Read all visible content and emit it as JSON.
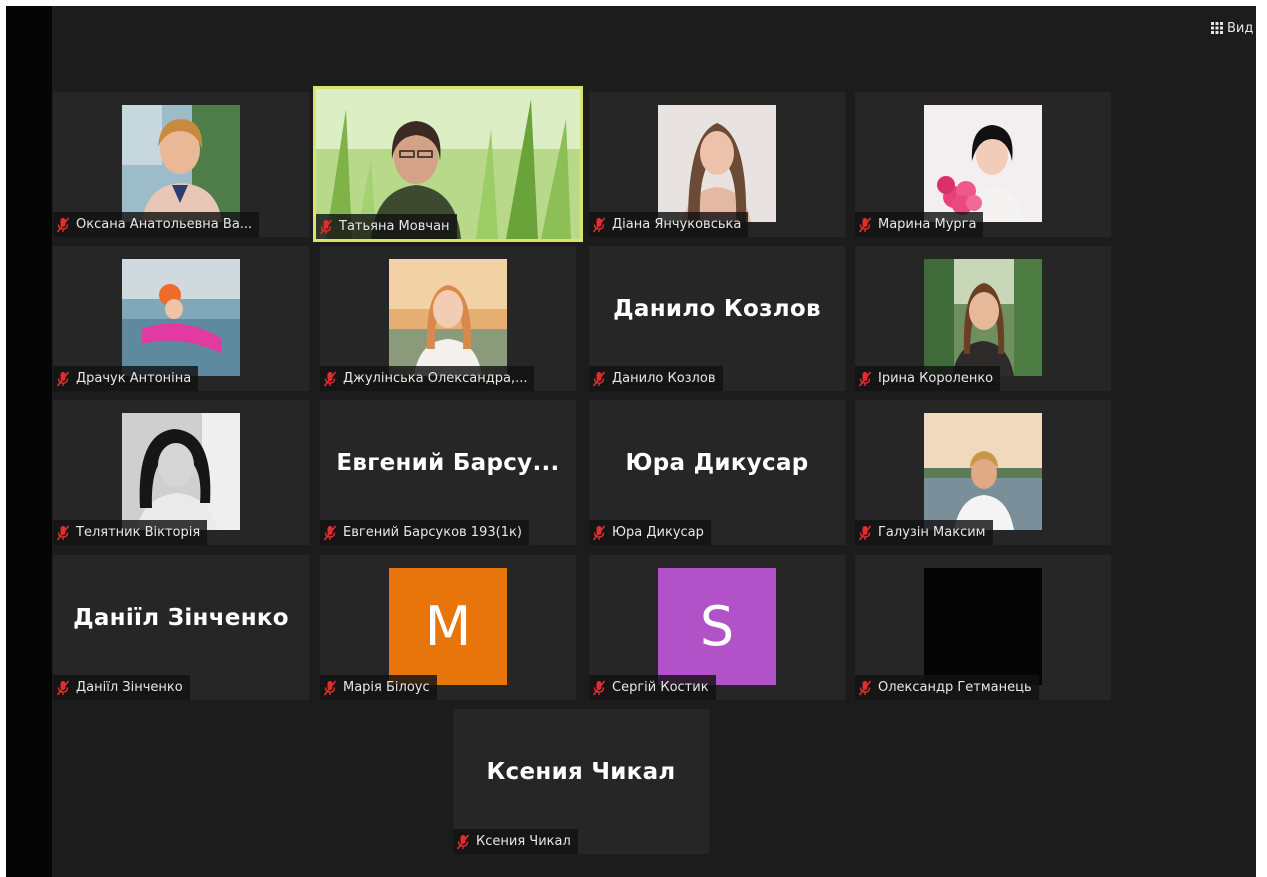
{
  "toolbar": {
    "view_label": "Вид"
  },
  "colors": {
    "background": "#1c1c1c",
    "tile": "#262626",
    "active_border": "#d9e36e",
    "muted_mic": "#e02d2d"
  },
  "participants": [
    {
      "name": "Оксана Анатольевна Ва...",
      "avatar": "photo"
    },
    {
      "name": "Татьяна Мовчан",
      "avatar": "photo",
      "speaking": true
    },
    {
      "name": "Діана Янчуковська",
      "avatar": "photo"
    },
    {
      "name": "Марина Мурга",
      "avatar": "photo"
    },
    {
      "name": "Драчук Антоніна",
      "avatar": "photo"
    },
    {
      "name": "Джулінська Олександра,...",
      "avatar": "photo"
    },
    {
      "name": "Данило Козлов",
      "display_name": "Данило Козлов",
      "avatar": "none"
    },
    {
      "name": "Ірина Короленко",
      "avatar": "photo"
    },
    {
      "name": "Телятник Вікторія",
      "avatar": "photo"
    },
    {
      "name": "Евгений Барсуков 193(1к)",
      "display_name": "Евгений  Барсу...",
      "avatar": "none"
    },
    {
      "name": "Юра Дикусар",
      "display_name": "Юра Дикусар",
      "avatar": "none"
    },
    {
      "name": "Галузін Максим",
      "avatar": "photo"
    },
    {
      "name": "Даніїл Зінченко",
      "display_name": "Даніїл Зінченко",
      "avatar": "none"
    },
    {
      "name": "Марія Білоус",
      "avatar": "letter",
      "letter": "M",
      "color": "#e8740c"
    },
    {
      "name": "Сергій Костик",
      "avatar": "letter",
      "letter": "S",
      "color": "#b152c8"
    },
    {
      "name": "Олександр Гетманець",
      "avatar": "black"
    },
    {
      "name": "Ксения Чикал",
      "display_name": "Ксения Чикал",
      "avatar": "none"
    }
  ]
}
